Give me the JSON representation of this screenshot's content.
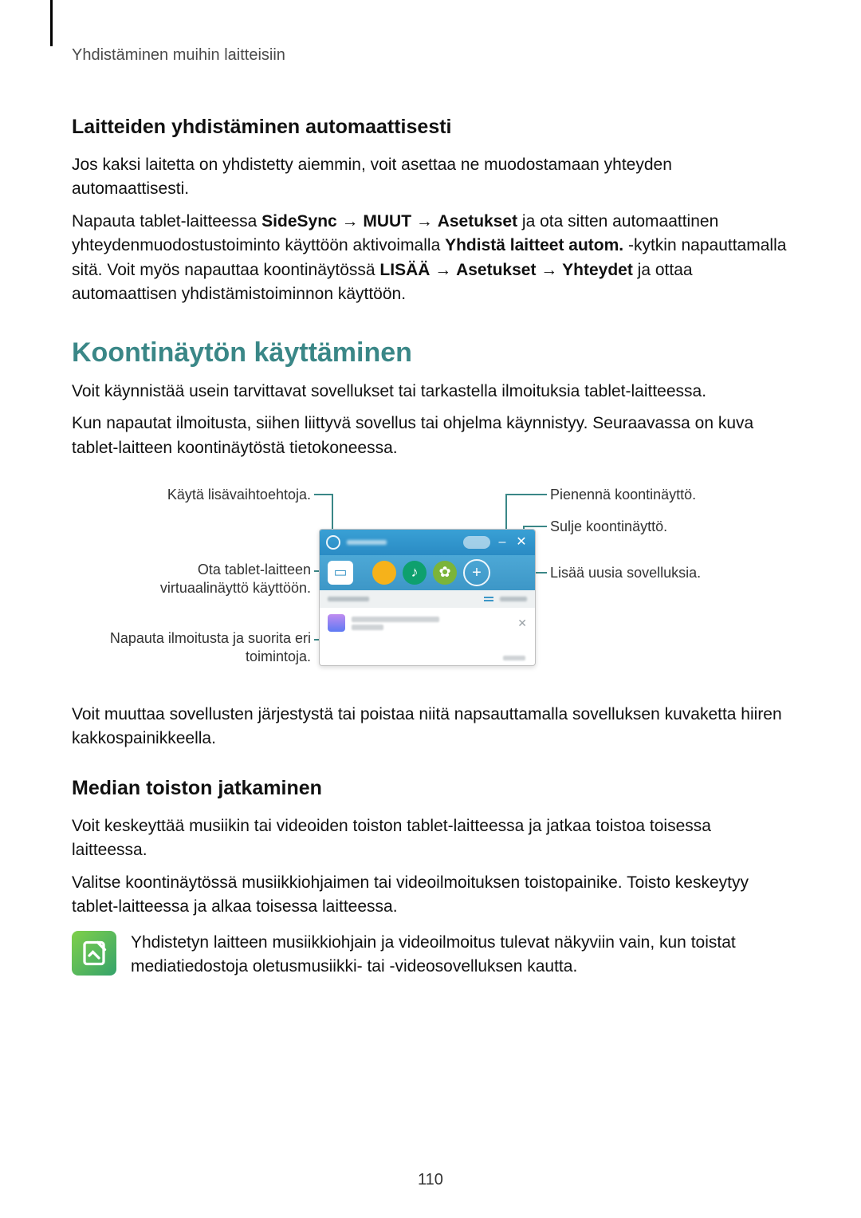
{
  "runningHeader": "Yhdistäminen muihin laitteisiin",
  "h_auto": "Laitteiden yhdistäminen automaattisesti",
  "p_auto1": "Jos kaksi laitetta on yhdistetty aiemmin, voit asettaa ne muodostamaan yhteyden automaattisesti.",
  "p_auto2_a": "Napauta tablet-laitteessa ",
  "p_auto2_b": "SideSync",
  "p_auto2_c": " → ",
  "p_auto2_d": "MUUT",
  "p_auto2_e": " → ",
  "p_auto2_f": "Asetukset",
  "p_auto2_g": " ja ota sitten automaattinen yhteydenmuodostustoiminto käyttöön aktivoimalla ",
  "p_auto2_h": "Yhdistä laitteet autom.",
  "p_auto2_i": " -kytkin napauttamalla sitä. Voit myös napauttaa koontinäytössä ",
  "p_auto2_j": "LISÄÄ",
  "p_auto2_k": " → ",
  "p_auto2_l": "Asetukset",
  "p_auto2_m": " → ",
  "p_auto2_n": "Yhteydet",
  "p_auto2_o": " ja ottaa automaattisen yhdistämistoiminnon käyttöön.",
  "h_koonti": "Koontinäytön käyttäminen",
  "p_koonti1": "Voit käynnistää usein tarvittavat sovellukset tai tarkastella ilmoituksia tablet-laitteessa.",
  "p_koonti2": "Kun napautat ilmoitusta, siihen liittyvä sovellus tai ohjelma käynnistyy. Seuraavassa on kuva tablet-laitteen koontinäytöstä tietokoneessa.",
  "callouts": {
    "options": "Käytä lisävaihtoehtoja.",
    "virtual_a": "Ota tablet-laitteen",
    "virtual_b": "virtuaalinäyttö käyttöön.",
    "notif_a": "Napauta ilmoitusta ja suorita eri",
    "notif_b": "toimintoja.",
    "minimize": "Pienennä koontinäyttö.",
    "close": "Sulje koontinäyttö.",
    "addapps": "Lisää uusia sovelluksia."
  },
  "p_after1": "Voit muuttaa sovellusten järjestystä tai poistaa niitä napsauttamalla sovelluksen kuvaketta hiiren kakkospainikkeella.",
  "h_media": "Median toiston jatkaminen",
  "p_media1": "Voit keskeyttää musiikin tai videoiden toiston tablet-laitteessa ja jatkaa toistoa toisessa laitteessa.",
  "p_media2": "Valitse koontinäytössä musiikkiohjaimen tai videoilmoituksen toistopainike. Toisto keskeytyy tablet-laitteessa ja alkaa toisessa laitteessa.",
  "note": "Yhdistetyn laitteen musiikkiohjain ja videoilmoitus tulevat näkyviin vain, kun toistat mediatiedostoja oletusmusiikki- tai -videosovelluksen kautta.",
  "pageNumber": "110"
}
